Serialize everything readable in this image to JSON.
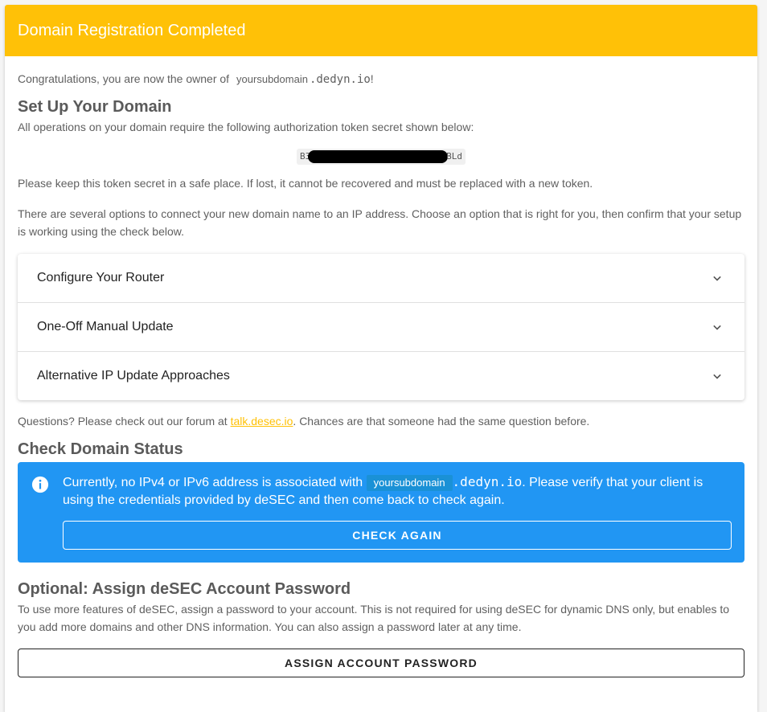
{
  "header": {
    "title": "Domain Registration Completed"
  },
  "congrats": {
    "prefix": "Congratulations, you are now the owner of",
    "subdomain": "yoursubdomain",
    "domain_suffix": ".dedyn.io",
    "suffix": "!"
  },
  "setup": {
    "heading": "Set Up Your Domain",
    "intro": "All operations on your domain require the following authorization token secret shown below:",
    "token_start": "B3",
    "token_end": "BLd",
    "keep_secret": "Please keep this token secret in a safe place. If lost, it cannot be recovered and must be replaced with a new token.",
    "options_text": "There are several options to connect your new domain name to an IP address. Choose an option that is right for you, then confirm that your setup is working using the check below."
  },
  "panels": [
    {
      "label": "Configure Your Router"
    },
    {
      "label": "One-Off Manual Update"
    },
    {
      "label": "Alternative IP Update Approaches"
    }
  ],
  "questions": {
    "prefix": "Questions? Please check out our forum at",
    "link": "talk.desec.io",
    "suffix": ". Chances are that someone had the same question before."
  },
  "status": {
    "heading": "Check Domain Status",
    "alert_prefix": "Currently, no IPv4 or IPv6 address is associated with",
    "alert_subdomain": "yoursubdomain",
    "alert_domain_suffix": ".dedyn.io",
    "alert_suffix": ". Please verify that your client is using the credentials provided by deSEC and then come back to check again.",
    "button": "CHECK AGAIN"
  },
  "password": {
    "heading": "Optional: Assign deSEC Account Password",
    "text": "To use more features of deSEC, assign a password to your account. This is not required for using deSEC for dynamic DNS only, but enables to you add more domains and other DNS information. You can also assign a password later at any time.",
    "button": "ASSIGN ACCOUNT PASSWORD"
  },
  "colors": {
    "accent": "#ffc107",
    "info": "#2196f3"
  }
}
